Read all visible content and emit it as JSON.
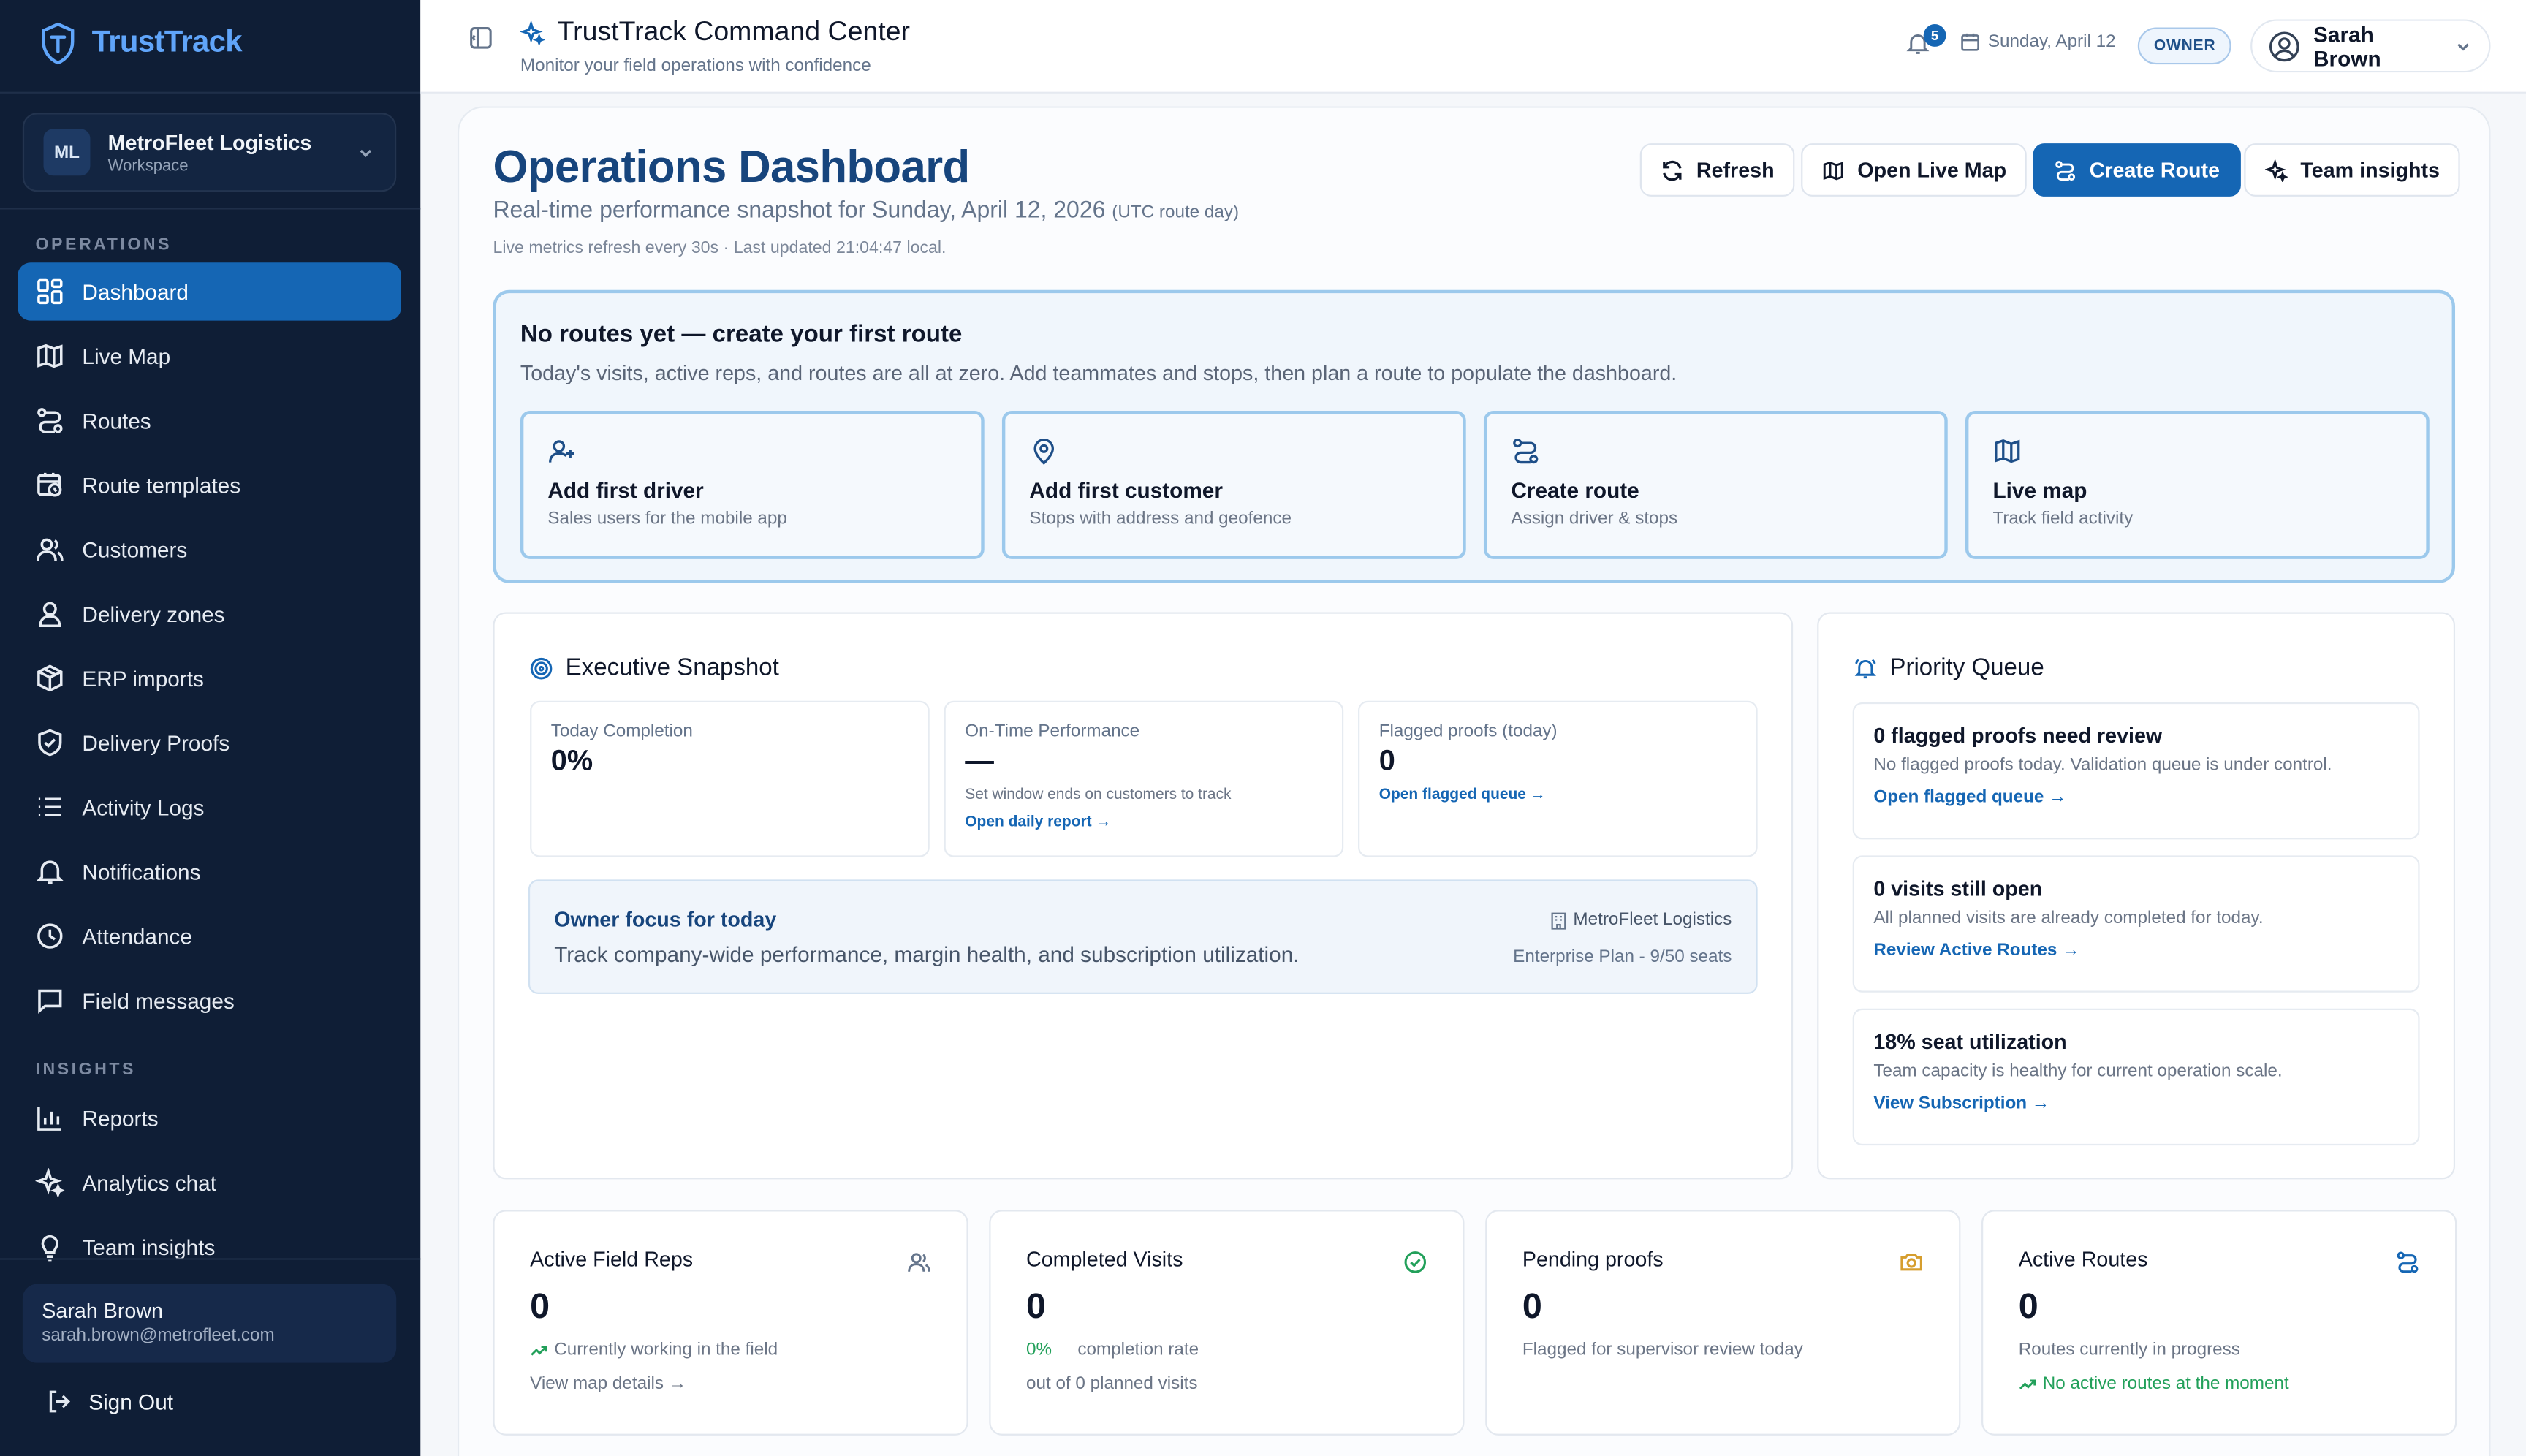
{
  "sidebar": {
    "brand": "TrustTrack",
    "workspace": {
      "initials": "ML",
      "name": "MetroFleet Logistics",
      "label": "Workspace"
    },
    "operations_label": "OPERATIONS",
    "operations": [
      {
        "label": "Dashboard",
        "icon": "dashboard-icon",
        "active": true
      },
      {
        "label": "Live Map",
        "icon": "map-icon"
      },
      {
        "label": "Routes",
        "icon": "route-icon"
      },
      {
        "label": "Route templates",
        "icon": "calendar-clock-icon"
      },
      {
        "label": "Customers",
        "icon": "users-icon"
      },
      {
        "label": "Delivery zones",
        "icon": "map-pin-user-icon"
      },
      {
        "label": "ERP imports",
        "icon": "package-icon"
      },
      {
        "label": "Delivery Proofs",
        "icon": "shield-check-icon"
      },
      {
        "label": "Activity Logs",
        "icon": "list-icon"
      },
      {
        "label": "Notifications",
        "icon": "bell-icon"
      },
      {
        "label": "Attendance",
        "icon": "clock-icon"
      },
      {
        "label": "Field messages",
        "icon": "message-square-icon"
      }
    ],
    "insights_label": "INSIGHTS",
    "insights": [
      {
        "label": "Reports",
        "icon": "bar-chart-icon"
      },
      {
        "label": "Analytics chat",
        "icon": "sparkles-icon"
      },
      {
        "label": "Team insights",
        "icon": "lightbulb-icon"
      }
    ],
    "user": {
      "name": "Sarah Brown",
      "email": "sarah.brown@metrofleet.com"
    },
    "sign_out": "Sign Out"
  },
  "header": {
    "title": "TrustTrack Command Center",
    "subtitle": "Monitor your field operations with confidence",
    "notifications": "5",
    "date": "Sunday, April 12",
    "role": "OWNER",
    "user": "Sarah Brown"
  },
  "dashboard": {
    "title": "Operations Dashboard",
    "subtitle": "Real-time performance snapshot for Sunday, April 12, 2026",
    "subtitle_note": "(UTC route day)",
    "meta": "Live metrics refresh every 30s · Last updated 21:04:47 local.",
    "buttons": {
      "refresh": "Refresh",
      "live_map": "Open Live Map",
      "create_route": "Create Route",
      "team_insights": "Team insights"
    }
  },
  "empty_state": {
    "title": "No routes yet — create your first route",
    "text": "Today's visits, active reps, and routes are all at zero. Add teammates and stops, then plan a route to populate the dashboard.",
    "actions": [
      {
        "title": "Add first driver",
        "sub": "Sales users for the mobile app",
        "icon": "user-plus-icon"
      },
      {
        "title": "Add first customer",
        "sub": "Stops with address and geofence",
        "icon": "map-pin-icon"
      },
      {
        "title": "Create route",
        "sub": "Assign driver & stops",
        "icon": "route-icon"
      },
      {
        "title": "Live map",
        "sub": "Track field activity",
        "icon": "map-icon"
      }
    ]
  },
  "executive": {
    "title": "Executive Snapshot",
    "metrics": [
      {
        "label": "Today Completion",
        "value": "0%"
      },
      {
        "label": "On-Time Performance",
        "value": "—",
        "note": "Set window ends on customers to track",
        "link": "Open daily report →"
      },
      {
        "label": "Flagged proofs (today)",
        "value": "0",
        "link": "Open flagged queue →"
      }
    ],
    "focus": {
      "title": "Owner focus for today",
      "text": "Track company-wide performance, margin health, and subscription utilization.",
      "company": "MetroFleet Logistics",
      "plan": "Enterprise Plan - 9/50 seats"
    }
  },
  "priority": {
    "title": "Priority Queue",
    "items": [
      {
        "title": "0 flagged proofs need review",
        "text": "No flagged proofs today. Validation queue is under control.",
        "link": "Open flagged queue →"
      },
      {
        "title": "0 visits still open",
        "text": "All planned visits are already completed for today.",
        "link": "Review Active Routes →"
      },
      {
        "title": "18% seat utilization",
        "text": "Team capacity is healthy for current operation scale.",
        "link": "View Subscription →"
      }
    ]
  },
  "stats": [
    {
      "label": "Active Field Reps",
      "value": "0",
      "note": "Currently working in the field",
      "link": "View map details →",
      "icon": "users-icon"
    },
    {
      "label": "Completed Visits",
      "value": "0",
      "pct": "0%",
      "note": "completion rate",
      "link": "out of 0 planned visits",
      "icon": "check-circle-icon"
    },
    {
      "label": "Pending proofs",
      "value": "0",
      "note": "Flagged for supervisor review today",
      "icon": "camera-icon"
    },
    {
      "label": "Active Routes",
      "value": "0",
      "note": "Routes currently in progress",
      "link": "No active routes at the moment",
      "icon": "route-icon"
    }
  ],
  "colors": {
    "sidebar_bg": "#0f1e36",
    "accent": "#1566b4",
    "title": "#17457d",
    "success": "#22a05a",
    "warning": "#d69e2e"
  }
}
